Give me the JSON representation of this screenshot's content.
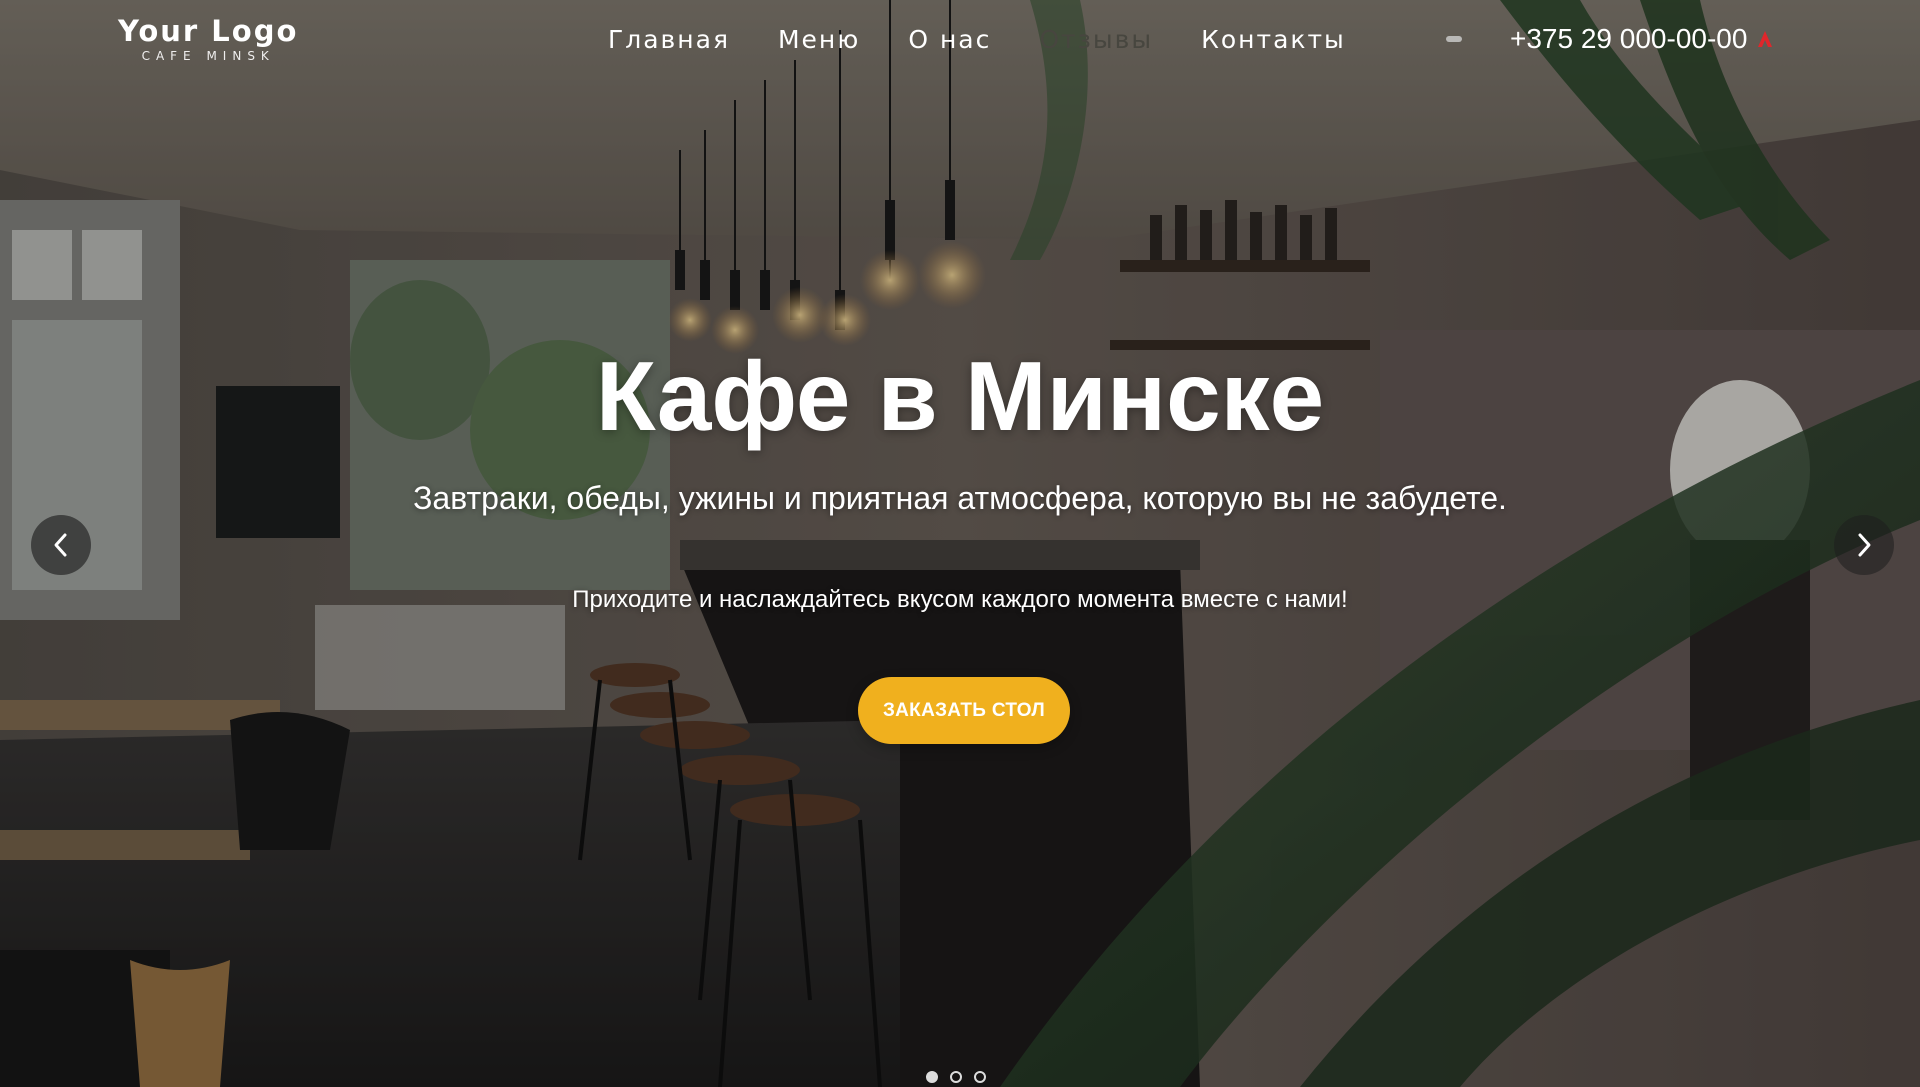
{
  "logo": {
    "title": "Your Logo",
    "subtitle": "CAFE MINSK"
  },
  "nav": {
    "items": [
      {
        "label": "Главная"
      },
      {
        "label": "Меню"
      },
      {
        "label": "О нас"
      },
      {
        "label": "Отзывы"
      },
      {
        "label": "Контакты"
      }
    ]
  },
  "header": {
    "phone": "+375 29 000-00-00"
  },
  "hero": {
    "title": "Кафе в Минске",
    "subtitle": "Завтраки, обеды, ужины и приятная атмосфера, которую вы не забудете.",
    "tagline": "Приходите и наслаждайтесь вкусом каждого момента вместе с нами!",
    "cta_label": "ЗАКАЗАТЬ СТОЛ"
  },
  "slider": {
    "slide_count": 3,
    "active_slide": 1
  },
  "colors": {
    "accent": "#f0b01e",
    "text": "#ffffff"
  },
  "icons": {
    "prev": "chevron-left-icon",
    "next": "chevron-right-icon",
    "phone_brand": "brand-icon"
  }
}
